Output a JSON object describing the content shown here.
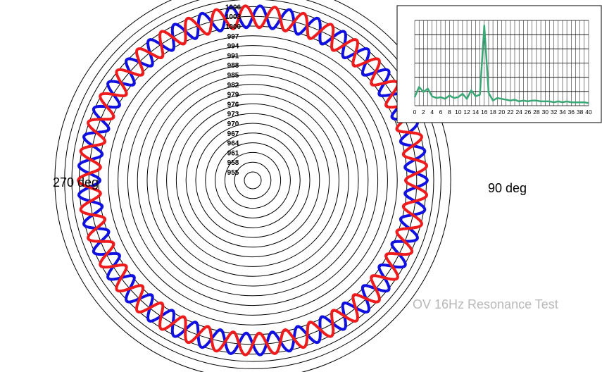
{
  "chart_data": [
    {
      "type": "polar-line",
      "title": "OV 16Hz Resonance Test",
      "angle_labels": {
        "right": "90 deg",
        "left": "270 deg"
      },
      "radial_ticks": [
        955,
        958,
        961,
        964,
        967,
        970,
        973,
        976,
        979,
        982,
        985,
        988,
        991,
        994,
        997,
        1000,
        1003,
        1006
      ],
      "rlim": [
        955,
        1006
      ],
      "series": [
        {
          "color": "#1010e0",
          "baseline": 997.5,
          "amplitude": 3.0,
          "cycles": 37,
          "phase_deg": 0,
          "angle_range_deg": [
            0,
            360
          ]
        },
        {
          "color": "#ee1c1c",
          "baseline": 997.5,
          "amplitude": 3.0,
          "cycles": 37,
          "phase_deg": 180,
          "angle_range_deg": [
            0,
            360
          ]
        }
      ]
    },
    {
      "type": "line",
      "x": [
        0,
        1,
        2,
        3,
        4,
        5,
        6,
        7,
        8,
        9,
        10,
        11,
        12,
        13,
        14,
        15,
        16,
        17,
        18,
        19,
        20,
        21,
        22,
        23,
        24,
        25,
        26,
        27,
        28,
        29,
        30,
        31,
        32,
        33,
        34,
        35,
        36,
        37,
        38,
        39,
        40
      ],
      "values": [
        1.0,
        2.2,
        1.6,
        2.0,
        1.1,
        0.9,
        1.0,
        0.8,
        1.2,
        0.9,
        1.0,
        1.4,
        0.8,
        1.8,
        1.1,
        1.3,
        9.4,
        1.5,
        0.6,
        0.9,
        0.8,
        0.7,
        0.6,
        0.7,
        0.5,
        0.6,
        0.5,
        0.6,
        0.6,
        0.5,
        0.5,
        0.5,
        0.4,
        0.5,
        0.4,
        0.5,
        0.4,
        0.4,
        0.4,
        0.4,
        0.3
      ],
      "color": "#3aa876",
      "xlim": [
        0,
        40
      ],
      "ylim": [
        0,
        10
      ],
      "tick_labels": [
        "0",
        "2",
        "4",
        "6",
        "8",
        "10",
        "12",
        "14",
        "16",
        "18",
        "20",
        "22",
        "24",
        "26",
        "28",
        "30",
        "32",
        "34",
        "36",
        "38",
        "40"
      ],
      "grid": true
    }
  ]
}
